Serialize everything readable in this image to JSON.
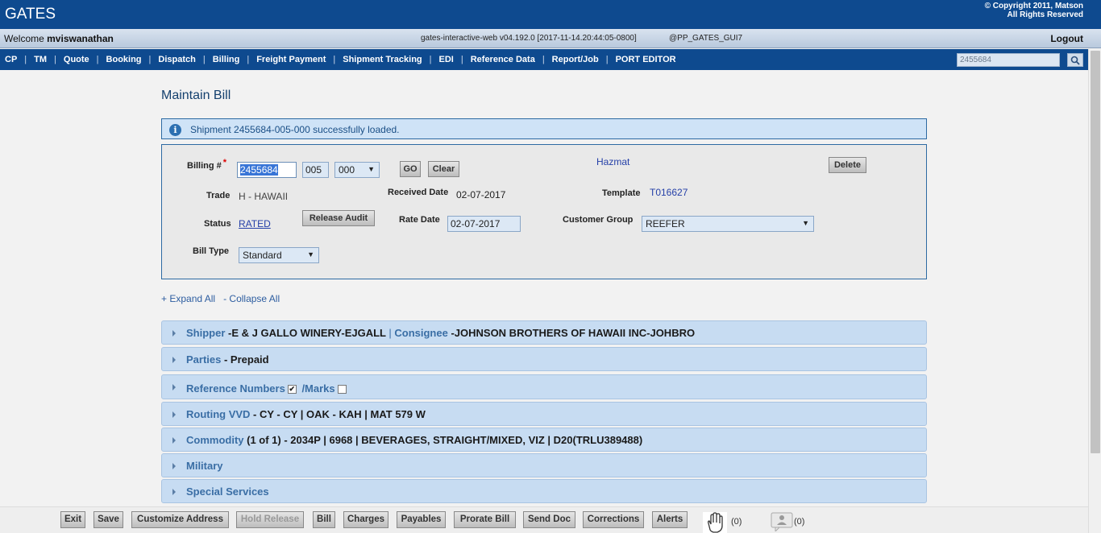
{
  "app": {
    "title": "GATES",
    "copyright_line1": "© Copyright 2011, Matson",
    "copyright_line2": "All Rights Reserved"
  },
  "welcome": {
    "prefix": "Welcome ",
    "user": "mviswanathan",
    "version": "gates-interactive-web v04.192.0 [2017-11-14.20:44:05-0800]",
    "server": "@PP_GATES_GUI7",
    "logout": "Logout"
  },
  "nav": {
    "items": [
      "CP",
      "TM",
      "Quote",
      "Booking",
      "Dispatch",
      "Billing",
      "Freight Payment",
      "Shipment Tracking",
      "EDI",
      "Reference Data",
      "Report/Job",
      "PORT EDITOR"
    ],
    "search_value": "2455684"
  },
  "page": {
    "title": "Maintain Bill",
    "message": "Shipment 2455684-005-000 successfully loaded."
  },
  "form": {
    "billing_label": "Billing #",
    "billing_required": "*",
    "billing_number": "2455684",
    "billing_seq": "005",
    "billing_split": "000",
    "go": "GO",
    "clear": "Clear",
    "hazmat": "Hazmat",
    "delete": "Delete",
    "trade_label": "Trade",
    "trade_value": "H - HAWAII",
    "received_label": "Received Date",
    "received_value": "02-07-2017",
    "template_label": "Template",
    "template_value": "T016627",
    "status_label": "Status",
    "status_value": "RATED",
    "release_audit": "Release Audit",
    "rate_date_label": "Rate Date",
    "rate_date_value": "02-07-2017",
    "customer_group_label": "Customer Group",
    "customer_group_value": "REEFER",
    "bill_type_label": "Bill Type",
    "bill_type_value": "Standard"
  },
  "expand": {
    "expand_all": "+ Expand All",
    "collapse_all": "- Collapse All"
  },
  "panels": {
    "shipper": {
      "label": "Shipper",
      "value": " -E & J GALLO WINERY-EJGALL ",
      "sep": "| ",
      "consignee_label": "Consignee",
      "consignee_value": " -JOHNSON BROTHERS OF HAWAII INC-JOHBRO"
    },
    "parties": {
      "label": "Parties",
      "value": " - Prepaid"
    },
    "reference": {
      "label": "Reference Numbers",
      "marks": " /Marks"
    },
    "routing": {
      "label": "Routing VVD",
      "value": " - CY - CY | OAK - KAH | MAT 579 W"
    },
    "commodity": {
      "label": "Commodity",
      "value": " (1 of 1) - 2034P | 6968 | BEVERAGES, STRAIGHT/MIXED, VIZ | D20(TRLU389488)"
    },
    "military": {
      "label": "Military"
    },
    "special": {
      "label": "Special Services"
    }
  },
  "bottom": {
    "buttons": [
      "Exit",
      "Save",
      "Customize Address",
      "Hold Release",
      "Bill",
      "Charges",
      "Payables",
      "Prorate Bill",
      "Send Doc",
      "Corrections",
      "Alerts"
    ],
    "hold_count": "(0)",
    "user_count": "(0)"
  },
  "colors": {
    "brand": "#0e4a8f",
    "panel": "#c7dcf2",
    "link": "#2540a8"
  }
}
